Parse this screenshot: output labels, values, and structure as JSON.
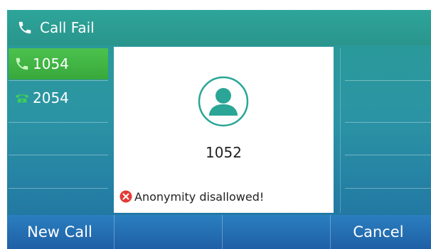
{
  "header": {
    "title": "Call Fail",
    "icon": "phone-handset-icon"
  },
  "lines": [
    {
      "label": "1054",
      "active": true,
      "icon": "phone-handset-icon"
    },
    {
      "label": "2054",
      "active": false,
      "icon": "desk-phone-icon"
    }
  ],
  "popup": {
    "avatar_icon": "contact-avatar-icon",
    "number": "1052",
    "error_icon": "error-x-icon",
    "error_text": "Anonymity disallowed!"
  },
  "softkeys": [
    "New Call",
    "",
    "",
    "Cancel"
  ],
  "colors": {
    "active_line": "#43b946",
    "avatar_teal": "#2aa596",
    "error_red": "#e53935",
    "softkey_bar": "#2472b3"
  }
}
